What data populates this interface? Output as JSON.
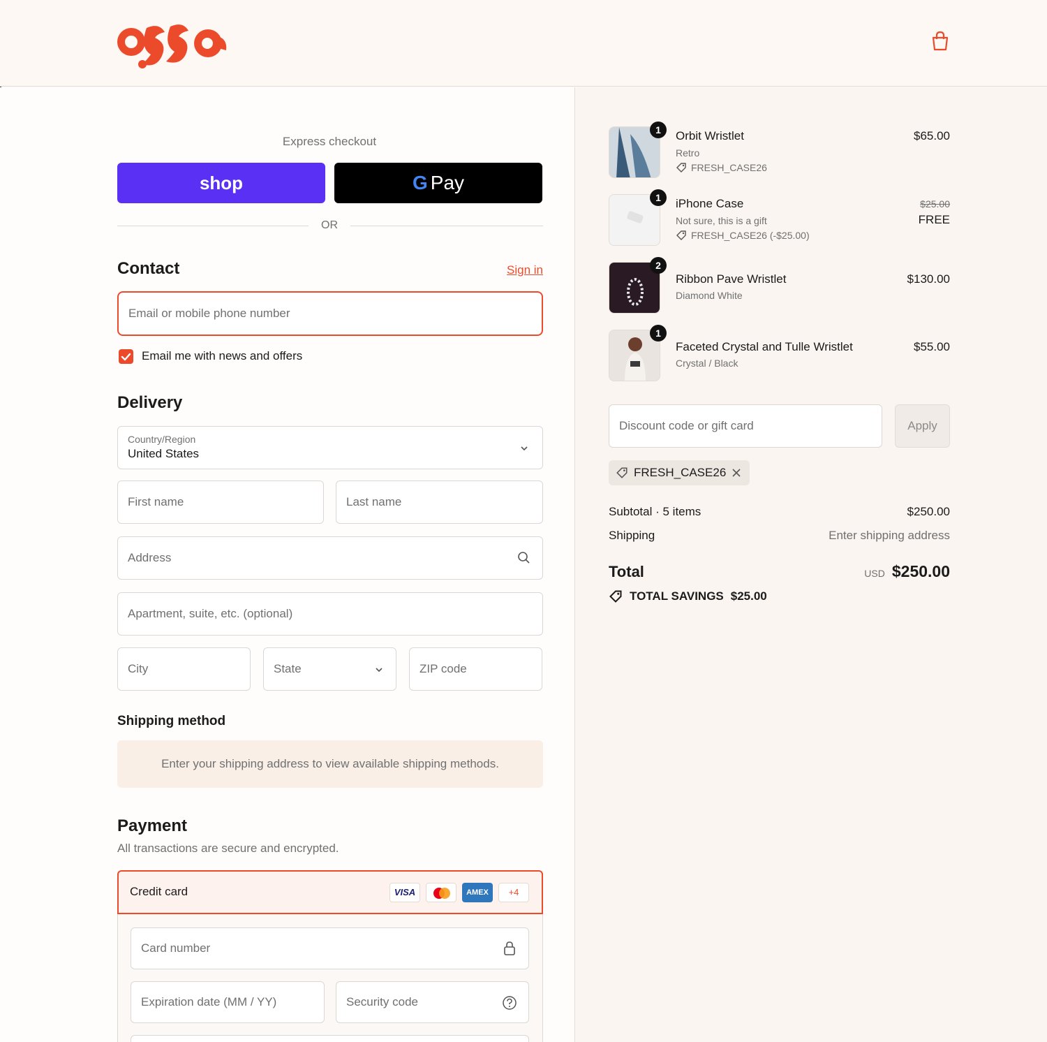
{
  "colors": {
    "brand": "#ec4b2b",
    "shop_pay": "#5a31f4",
    "gpay": "#000000",
    "accent_bg": "#f9efe7"
  },
  "header": {
    "logo_text": "ossa",
    "cart_icon": "shopping-bag-icon"
  },
  "express": {
    "title": "Express checkout",
    "shop_label": "shop",
    "gpay_g": "G",
    "gpay_label": "Pay",
    "or_label": "OR"
  },
  "contact": {
    "title": "Contact",
    "sign_in": "Sign in",
    "email_placeholder": "Email or mobile phone number",
    "newsletter_label": "Email me with news and offers",
    "newsletter_checked": true
  },
  "delivery": {
    "title": "Delivery",
    "country_label": "Country/Region",
    "country_value": "United States",
    "first_name": "First name",
    "last_name": "Last name",
    "address": "Address",
    "apartment": "Apartment, suite, etc. (optional)",
    "city": "City",
    "state": "State",
    "zip": "ZIP code"
  },
  "shipping": {
    "title": "Shipping method",
    "notice": "Enter your shipping address to view available shipping methods."
  },
  "payment": {
    "title": "Payment",
    "subtitle": "All transactions are secure and encrypted.",
    "method_label": "Credit card",
    "brands": [
      "VISA",
      "AMEX",
      "+4"
    ],
    "card_number": "Card number",
    "expiration": "Expiration date (MM / YY)",
    "security_code": "Security code"
  },
  "cart": {
    "items": [
      {
        "qty": "1",
        "title": "Orbit Wristlet",
        "variant": "Retro",
        "discount": "FRESH_CASE26",
        "price": "$65.00",
        "original_price": ""
      },
      {
        "qty": "1",
        "title": "iPhone Case",
        "variant": "Not sure, this is a gift",
        "discount": "FRESH_CASE26 (-$25.00)",
        "price": "FREE",
        "original_price": "$25.00"
      },
      {
        "qty": "2",
        "title": "Ribbon Pave Wristlet",
        "variant": "Diamond White",
        "discount": "",
        "price": "$130.00",
        "original_price": ""
      },
      {
        "qty": "1",
        "title": "Faceted Crystal and Tulle Wristlet",
        "variant": "Crystal / Black",
        "discount": "",
        "price": "$55.00",
        "original_price": ""
      }
    ],
    "discount_placeholder": "Discount code or gift card",
    "apply_label": "Apply",
    "applied_code": "FRESH_CASE26",
    "subtotal_label": "Subtotal · 5 items",
    "subtotal_value": "$250.00",
    "shipping_label": "Shipping",
    "shipping_value": "Enter shipping address",
    "total_label": "Total",
    "currency": "USD",
    "total_value": "$250.00",
    "savings_label": "TOTAL SAVINGS",
    "savings_value": "$25.00"
  }
}
